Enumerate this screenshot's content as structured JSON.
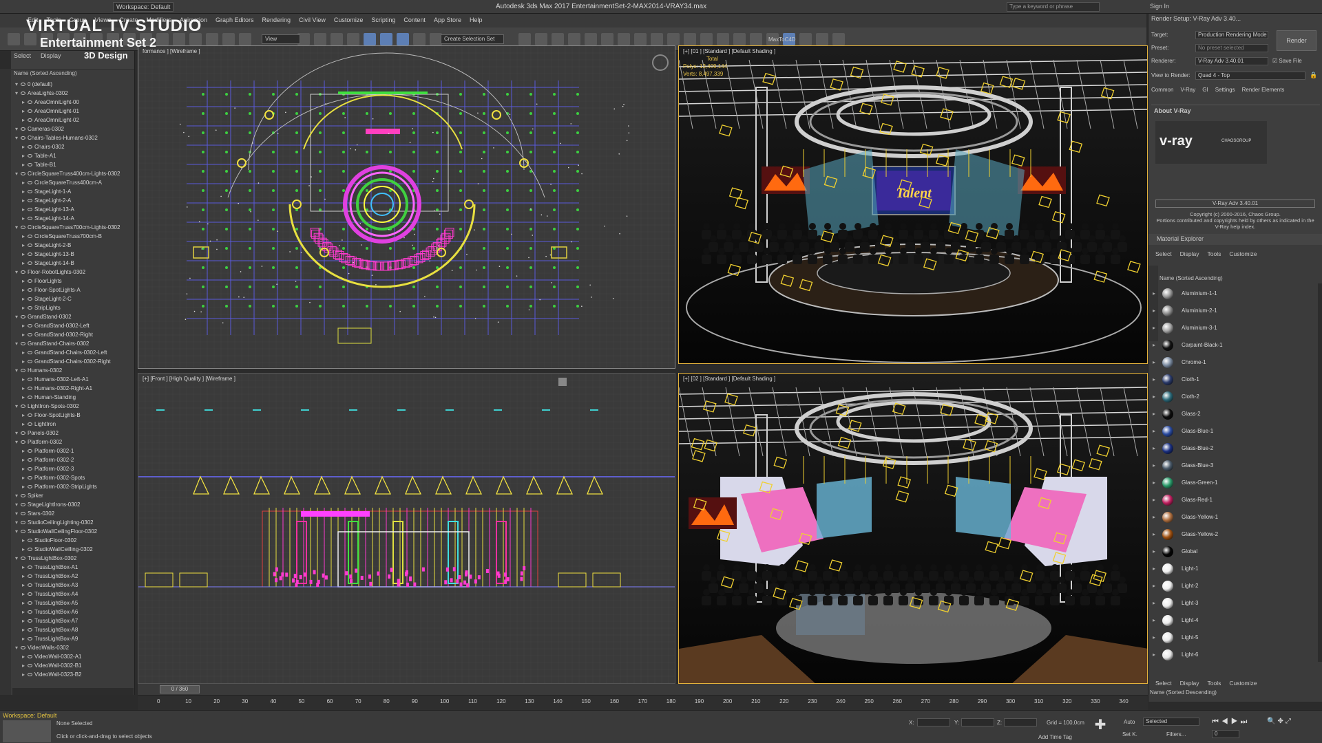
{
  "watermark": {
    "line1": "VIRTUAL TV STUDIO",
    "line2": "Entertainment Set 2",
    "line3": "3D Design"
  },
  "titlebar": {
    "workspace": "Workspace: Default",
    "title": "Autodesk 3ds Max 2017     EntertainmentSet-2-MAX2014-VRAY34.max",
    "search_placeholder": "Type a keyword or phrase",
    "sign_in": "Sign In"
  },
  "menus": [
    "Edit",
    "Tools",
    "Group",
    "Views",
    "Create",
    "Modifiers",
    "Animation",
    "Graph Editors",
    "Rendering",
    "Civil View",
    "Customize",
    "Scripting",
    "Content",
    "App Store",
    "Help"
  ],
  "toolbar": {
    "view_dropdown": "View",
    "selection_set": "Create Selection Set",
    "maxtoc4d": "MaxToC4D"
  },
  "scene_explorer": {
    "tabs": [
      "Select",
      "Display"
    ],
    "header": "Name (Sorted Ascending)",
    "items": [
      {
        "name": "0 (default)",
        "indent": 0
      },
      {
        "name": "AreaLights-0302",
        "indent": 0
      },
      {
        "name": "AreaOmniLight-00",
        "indent": 1
      },
      {
        "name": "AreaOmniLight-01",
        "indent": 1
      },
      {
        "name": "AreaOmniLight-02",
        "indent": 1
      },
      {
        "name": "Cameras-0302",
        "indent": 0
      },
      {
        "name": "Chairs-Tables-Humans-0302",
        "indent": 0
      },
      {
        "name": "Chairs-0302",
        "indent": 1
      },
      {
        "name": "Table-A1",
        "indent": 1
      },
      {
        "name": "Table-B1",
        "indent": 1
      },
      {
        "name": "CircleSquareTruss400cm-Lights-0302",
        "indent": 0
      },
      {
        "name": "CircleSquareTruss400cm-A",
        "indent": 1
      },
      {
        "name": "StageLight-1-A",
        "indent": 1
      },
      {
        "name": "StageLight-2-A",
        "indent": 1
      },
      {
        "name": "StageLight-13-A",
        "indent": 1
      },
      {
        "name": "StageLight-14-A",
        "indent": 1
      },
      {
        "name": "CircleSquareTruss700cm-Lights-0302",
        "indent": 0
      },
      {
        "name": "CircleSquareTruss700cm-B",
        "indent": 1
      },
      {
        "name": "StageLight-2-B",
        "indent": 1
      },
      {
        "name": "StageLight-13-B",
        "indent": 1
      },
      {
        "name": "StageLight-14-B",
        "indent": 1
      },
      {
        "name": "Floor-RobotLights-0302",
        "indent": 0
      },
      {
        "name": "FloorLights",
        "indent": 1
      },
      {
        "name": "Floor-SpotLights-A",
        "indent": 1
      },
      {
        "name": "StageLight-2-C",
        "indent": 1
      },
      {
        "name": "StripLights",
        "indent": 1
      },
      {
        "name": "GrandStand-0302",
        "indent": 0
      },
      {
        "name": "GrandStand-0302-Left",
        "indent": 1
      },
      {
        "name": "GrandStand-0302-Right",
        "indent": 1
      },
      {
        "name": "GrandStand-Chairs-0302",
        "indent": 0
      },
      {
        "name": "GrandStand-Chairs-0302-Left",
        "indent": 1
      },
      {
        "name": "GrandStand-Chairs-0302-Right",
        "indent": 1
      },
      {
        "name": "Humans-0302",
        "indent": 0
      },
      {
        "name": "Humans-0302-Left-A1",
        "indent": 1
      },
      {
        "name": "Humans-0302-Right-A1",
        "indent": 1
      },
      {
        "name": "Human-Standing",
        "indent": 1
      },
      {
        "name": "LightIron-Spots-0302",
        "indent": 0
      },
      {
        "name": "Floor-SpotLights-B",
        "indent": 1
      },
      {
        "name": "LightIron",
        "indent": 1
      },
      {
        "name": "Panels-0302",
        "indent": 0
      },
      {
        "name": "Platform-0302",
        "indent": 0
      },
      {
        "name": "Platform-0302-1",
        "indent": 1
      },
      {
        "name": "Platform-0302-2",
        "indent": 1
      },
      {
        "name": "Platform-0302-3",
        "indent": 1
      },
      {
        "name": "Platform-0302-Spots",
        "indent": 1
      },
      {
        "name": "Platform-0302-StripLights",
        "indent": 1
      },
      {
        "name": "Spiker",
        "indent": 0
      },
      {
        "name": "StageLightIrons-0302",
        "indent": 0
      },
      {
        "name": "Stars-0302",
        "indent": 0
      },
      {
        "name": "StudioCeilingLighting-0302",
        "indent": 0
      },
      {
        "name": "StudioWallCeilingFloor-0302",
        "indent": 0
      },
      {
        "name": "StudioFloor-0302",
        "indent": 1
      },
      {
        "name": "StudioWallCeilling-0302",
        "indent": 1
      },
      {
        "name": "TrussLightBox-0302",
        "indent": 0
      },
      {
        "name": "TrussLightBox-A1",
        "indent": 1
      },
      {
        "name": "TrussLightBox-A2",
        "indent": 1
      },
      {
        "name": "TrussLightBox-A3",
        "indent": 1
      },
      {
        "name": "TrussLightBox-A4",
        "indent": 1
      },
      {
        "name": "TrussLightBox-A5",
        "indent": 1
      },
      {
        "name": "TrussLightBox-A6",
        "indent": 1
      },
      {
        "name": "TrussLightBox-A7",
        "indent": 1
      },
      {
        "name": "TrussLightBox-A8",
        "indent": 1
      },
      {
        "name": "TrussLightBox-A9",
        "indent": 1
      },
      {
        "name": "VideoWalls-0302",
        "indent": 0
      },
      {
        "name": "VideoWall-0302-A1",
        "indent": 1
      },
      {
        "name": "VideoWall-0302-B1",
        "indent": 1
      },
      {
        "name": "VideoWall-0323-B2",
        "indent": 1
      }
    ],
    "workspace": "Workspace: Default"
  },
  "viewports": {
    "top": "formance ] [Wireframe ]",
    "front": "[+] [Front ] [High Quality ] [Wireframe ]",
    "cam1": "[+] [01 ] [Standard ] [Default Shading ]",
    "cam2": "[+] [02 ] [Standard ] [Default Shading ]",
    "stats": {
      "total": "Total",
      "polys_label": "Polys:",
      "polys": "13,409,144",
      "verts_label": "Verts:",
      "verts": "8,497,339"
    },
    "screen_text": "Talent"
  },
  "time": {
    "frame": "0 / 360",
    "ticks": [
      "0",
      "10",
      "20",
      "30",
      "40",
      "50",
      "60",
      "70",
      "80",
      "90",
      "100",
      "110",
      "120",
      "130",
      "140",
      "150",
      "160",
      "170",
      "180",
      "190",
      "200",
      "210",
      "220",
      "230",
      "240",
      "250",
      "260",
      "270",
      "280",
      "290",
      "300",
      "310",
      "320",
      "330",
      "340"
    ]
  },
  "status": {
    "selected": "None Selected",
    "prompt": "Click or click-and-drag to select objects",
    "x_label": "X:",
    "y_label": "Y:",
    "z_label": "Z:",
    "grid": "Grid = 100,0cm",
    "add_time_tag": "Add Time Tag",
    "auto": "Auto",
    "set_key": "Set K.",
    "selected_dd": "Selected",
    "filters": "Filters...",
    "frame_field": "0"
  },
  "render_setup": {
    "title": "Render Setup: V-Ray Adv 3.40...",
    "target_label": "Target:",
    "target": "Production Rendering Mode",
    "preset_label": "Preset:",
    "preset": "No preset selected",
    "renderer_label": "Renderer:",
    "renderer": "V-Ray Adv 3.40.01",
    "save_file": "Save File",
    "view_label": "View to Render:",
    "view": "Quad 4 - Top",
    "render_btn": "Render",
    "tabs": [
      "Common",
      "V-Ray",
      "GI",
      "Settings",
      "Render Elements"
    ],
    "section": "About V-Ray",
    "logo": "v-ray",
    "chaos": "CHAOSGROUP",
    "version": "V-Ray Adv 3.40.01",
    "copyright": "Copyright (c) 2000-2016, Chaos Group.",
    "portions": "Portions contributed and copyrights held by others as indicated in the V-Ray help index."
  },
  "material_explorer": {
    "title": "Material Explorer",
    "menu": [
      "Select",
      "Display",
      "Tools",
      "Customize"
    ],
    "header": "Name (Sorted Ascending)",
    "materials": [
      {
        "name": "Aluminium-1-1",
        "color": "#9a9a9a"
      },
      {
        "name": "Aluminium-2-1",
        "color": "#8c8c8c"
      },
      {
        "name": "Aluminium-3-1",
        "color": "#a5a5a5"
      },
      {
        "name": "Carpaint-Black-1",
        "color": "#111111"
      },
      {
        "name": "Chrome-1",
        "color": "#7a8aa0"
      },
      {
        "name": "Cloth-1",
        "color": "#2a3a6a"
      },
      {
        "name": "Cloth-2",
        "color": "#2c6a7a"
      },
      {
        "name": "Glass-2",
        "color": "#0c0c0c"
      },
      {
        "name": "Glass-Blue-1",
        "color": "#2a4aa0"
      },
      {
        "name": "Glass-Blue-2",
        "color": "#1a2f80"
      },
      {
        "name": "Glass-Blue-3",
        "color": "#4a5a6a"
      },
      {
        "name": "Glass-Green-1",
        "color": "#2a9a6a"
      },
      {
        "name": "Glass-Red-1",
        "color": "#c02060"
      },
      {
        "name": "Glass-Yellow-1",
        "color": "#b07040"
      },
      {
        "name": "Glass-Yellow-2",
        "color": "#a05010"
      },
      {
        "name": "Global",
        "color": "#050505"
      },
      {
        "name": "Light-1",
        "color": "#f0f0f0"
      },
      {
        "name": "Light-2",
        "color": "#eeeeee"
      },
      {
        "name": "Light-3",
        "color": "#ececec"
      },
      {
        "name": "Light-4",
        "color": "#ebebeb"
      },
      {
        "name": "Light-5",
        "color": "#eaeaea"
      },
      {
        "name": "Light-6",
        "color": "#e8e8e8"
      }
    ],
    "bottom_menu": [
      "Select",
      "Display",
      "Tools",
      "Customize"
    ],
    "bottom_header": "Name (Sorted Descending)"
  }
}
